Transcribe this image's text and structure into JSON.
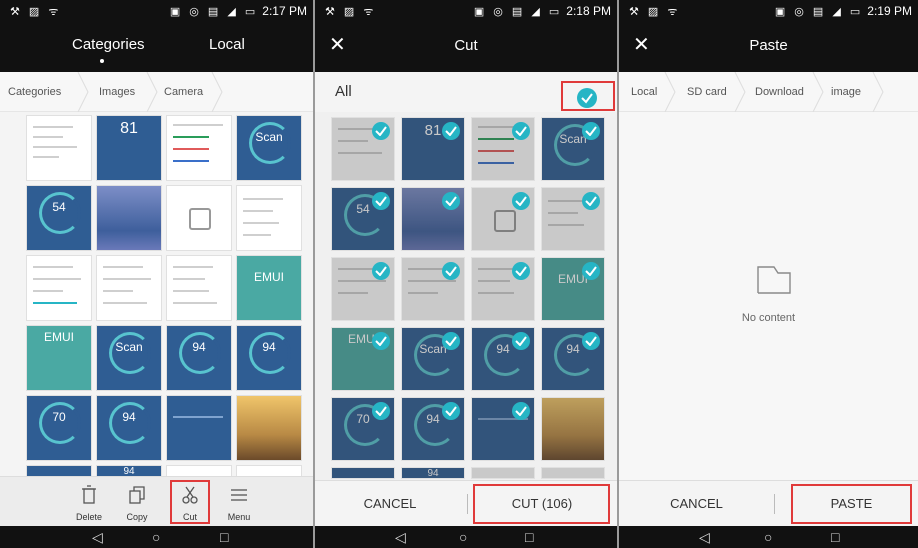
{
  "status": {
    "time_1": "2:17 PM",
    "time_2": "2:18 PM",
    "time_3": "2:19 PM"
  },
  "panel1": {
    "tabs": [
      "Categories",
      "Local"
    ],
    "breadcrumbs": [
      "Categories",
      "Images",
      "Camera"
    ],
    "thumb_texts": [
      "81",
      "Scan",
      "54",
      "EMUI",
      "EMUI",
      "Scan",
      "94",
      "94",
      "70",
      "94",
      "94"
    ],
    "toolbar": [
      {
        "label": "Delete",
        "icon": "trash-icon"
      },
      {
        "label": "Copy",
        "icon": "copy-icon"
      },
      {
        "label": "Cut",
        "icon": "scissors-icon"
      },
      {
        "label": "Menu",
        "icon": "menu-icon"
      }
    ]
  },
  "panel2": {
    "title": "Cut",
    "all_label": "All",
    "cancel_label": "CANCEL",
    "cut_label": "CUT (106)"
  },
  "panel3": {
    "title": "Paste",
    "breadcrumbs": [
      "Local",
      "SD card",
      "Download",
      "image"
    ],
    "empty_text": "No content",
    "cancel_label": "CANCEL",
    "paste_label": "PASTE"
  },
  "colors": {
    "accent": "#26b5c5",
    "highlight": "#e03a3a",
    "bar": "#111111"
  }
}
